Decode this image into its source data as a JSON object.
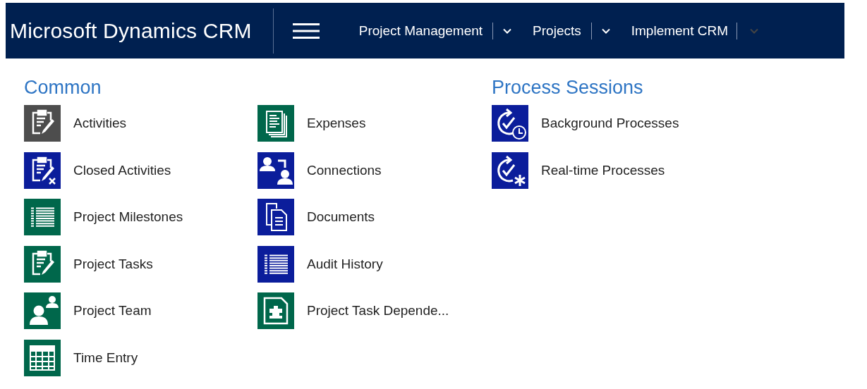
{
  "header": {
    "title": "Microsoft Dynamics CRM",
    "nav": [
      {
        "label": "Project Management"
      },
      {
        "label": "Projects"
      },
      {
        "label": "Implement CRM"
      }
    ]
  },
  "sections": [
    {
      "title": "Common",
      "items": [
        {
          "label": "Activities",
          "kind": "clipboard",
          "color": "#4d4d4d"
        },
        {
          "label": "Closed Activities",
          "kind": "clipboard-x",
          "color": "#0b1d9b"
        },
        {
          "label": "Project Milestones",
          "kind": "list",
          "color": "#00674b"
        },
        {
          "label": "Project Tasks",
          "kind": "clipboard",
          "color": "#00674b"
        },
        {
          "label": "Project Team",
          "kind": "team",
          "color": "#00674b"
        },
        {
          "label": "Time Entry",
          "kind": "calendar",
          "color": "#00674b"
        },
        {
          "label": "Expenses",
          "kind": "stack",
          "color": "#00674b"
        },
        {
          "label": "Connections",
          "kind": "connections",
          "color": "#0b1d9b"
        },
        {
          "label": "Documents",
          "kind": "documents",
          "color": "#0b1d9b"
        },
        {
          "label": "Audit History",
          "kind": "list",
          "color": "#0b1d9b"
        },
        {
          "label": "Project Task Depende...",
          "kind": "puzzle",
          "color": "#00674b"
        }
      ]
    },
    {
      "title": "Process Sessions",
      "items": [
        {
          "label": "Background Processes",
          "kind": "process-clock",
          "color": "#0b1d9b"
        },
        {
          "label": "Real-time Processes",
          "kind": "process-star",
          "color": "#0b1d9b"
        }
      ]
    }
  ]
}
